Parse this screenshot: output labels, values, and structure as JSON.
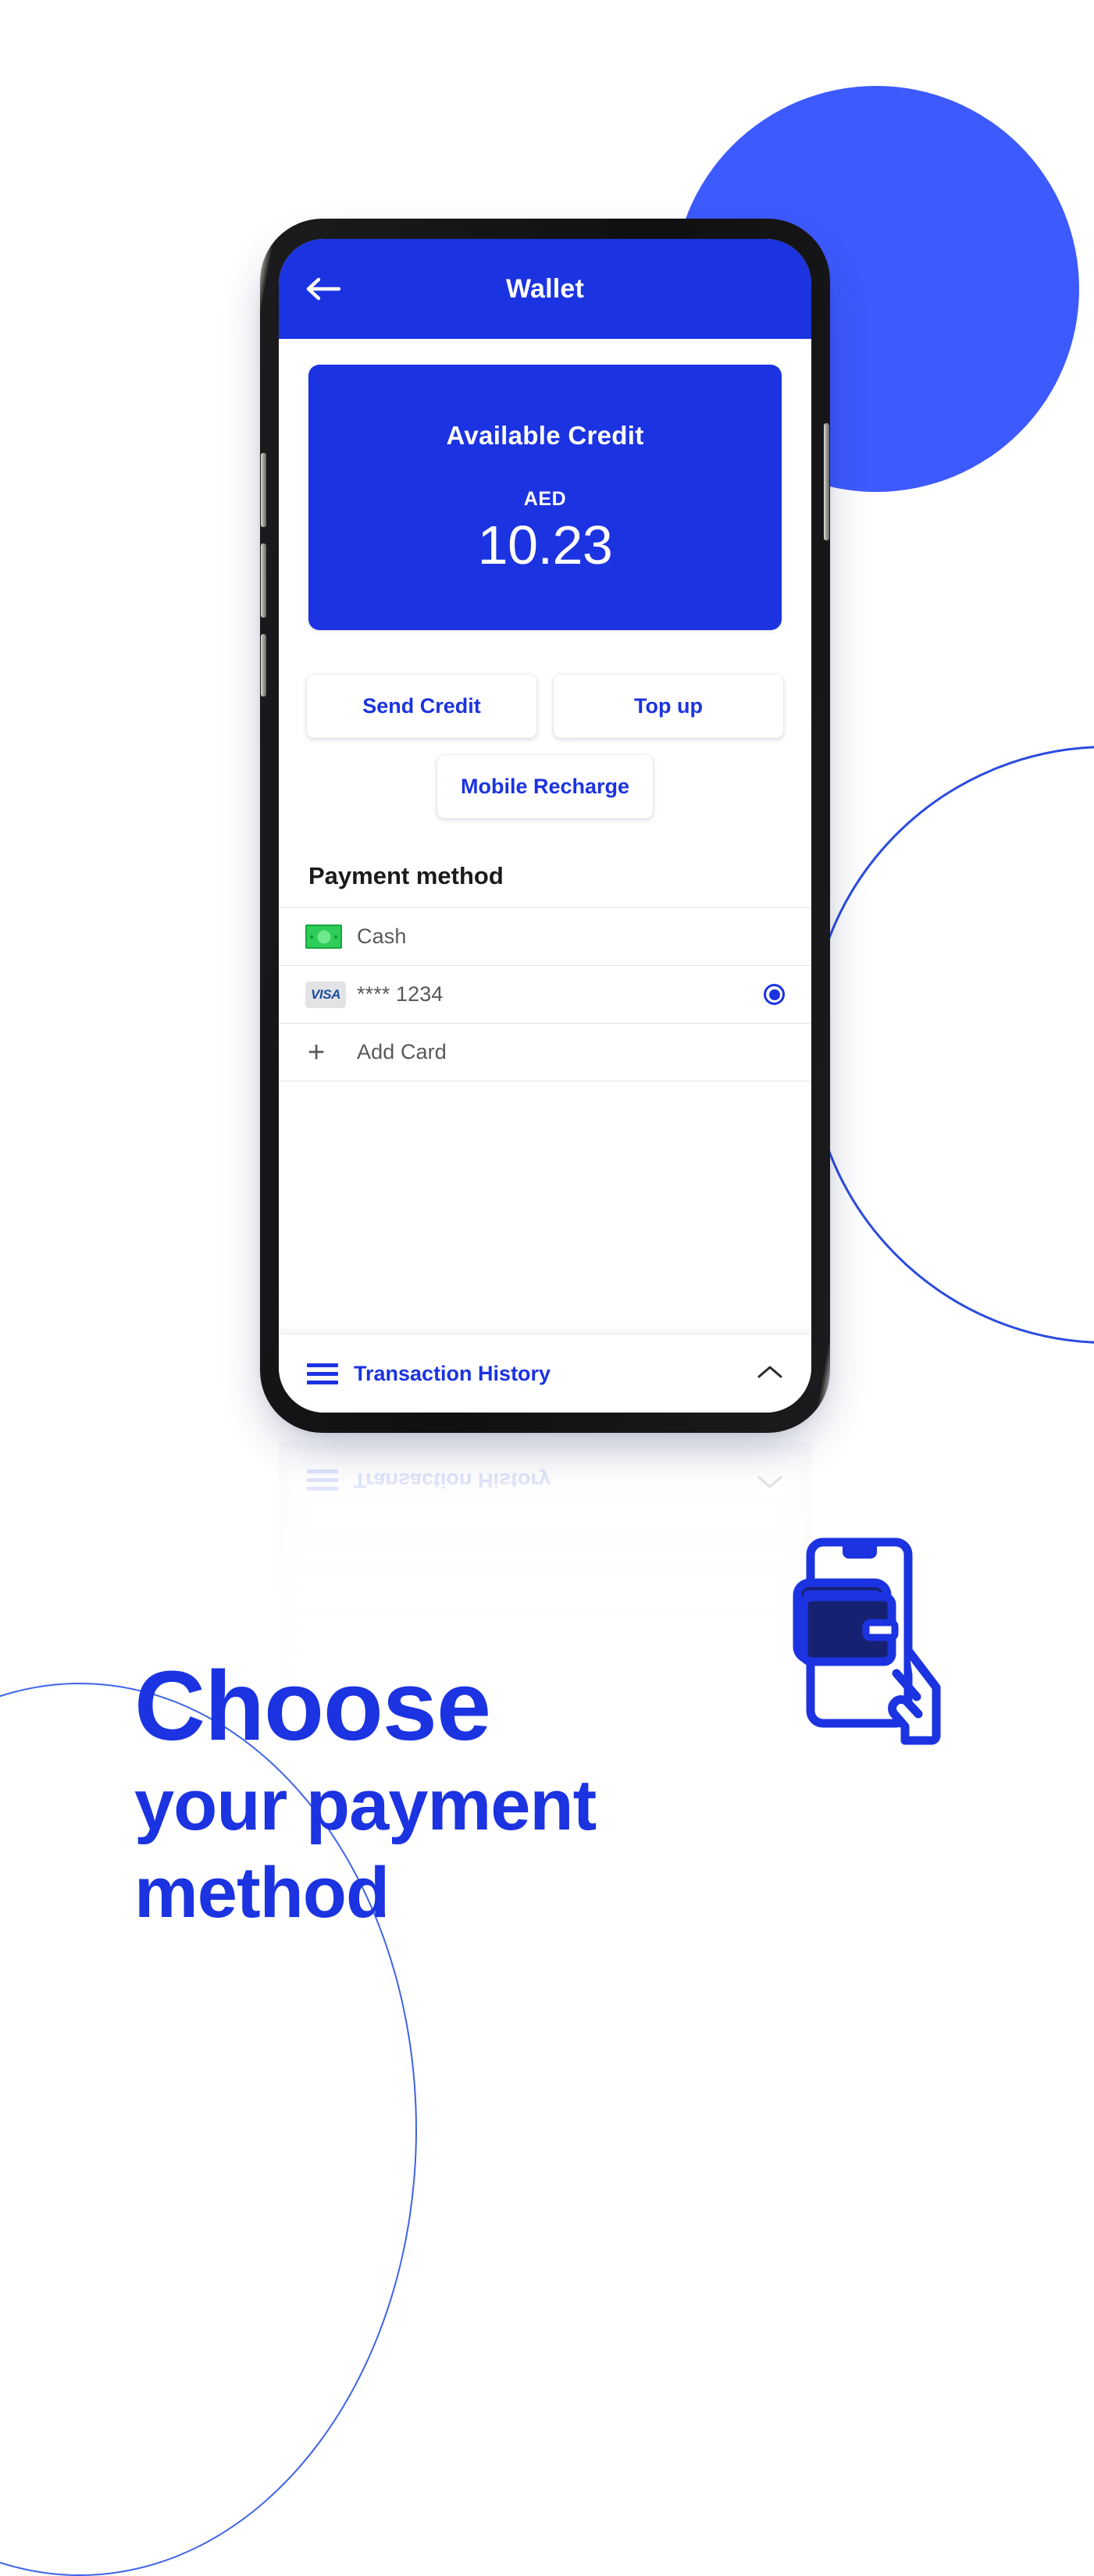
{
  "theme": {
    "brand_blue": "#1B33E0",
    "circle_blue": "#3D5AFE",
    "arc_blue": "#2B4BE0",
    "wallet_dark": "#162271",
    "cash_green": "#2ecc58",
    "visa_blue": "#1a4fa0",
    "text_grey": "#58595c"
  },
  "app": {
    "header": {
      "back_icon": "arrow-left-icon",
      "title": "Wallet"
    },
    "credit_card": {
      "label": "Available Credit",
      "currency": "AED",
      "amount": "10.23"
    },
    "quick_actions": [
      {
        "label": "Send Credit",
        "name": "send-credit-button"
      },
      {
        "label": "Top up",
        "name": "top-up-button"
      },
      {
        "label": "Mobile Recharge",
        "name": "mobile-recharge-button"
      }
    ],
    "payment_section": {
      "title": "Payment method",
      "methods": [
        {
          "label": "Cash",
          "icon": "cash-banknote-icon",
          "selected": false
        },
        {
          "label": "**** 1234",
          "icon": "visa-card-icon",
          "selected": true
        },
        {
          "label": "Add Card",
          "icon": "plus-icon",
          "selected": false
        }
      ]
    },
    "transaction_history": {
      "label": "Transaction History",
      "menu_icon": "hamburger-icon",
      "toggle_icon": "chevron-up-icon"
    }
  },
  "reflection": {
    "label": "Transaction History"
  },
  "headline": {
    "line1": "Choose",
    "line2": "your payment",
    "line3": "method"
  },
  "illustration": {
    "name": "phone-with-wallet-in-hand-icon"
  }
}
